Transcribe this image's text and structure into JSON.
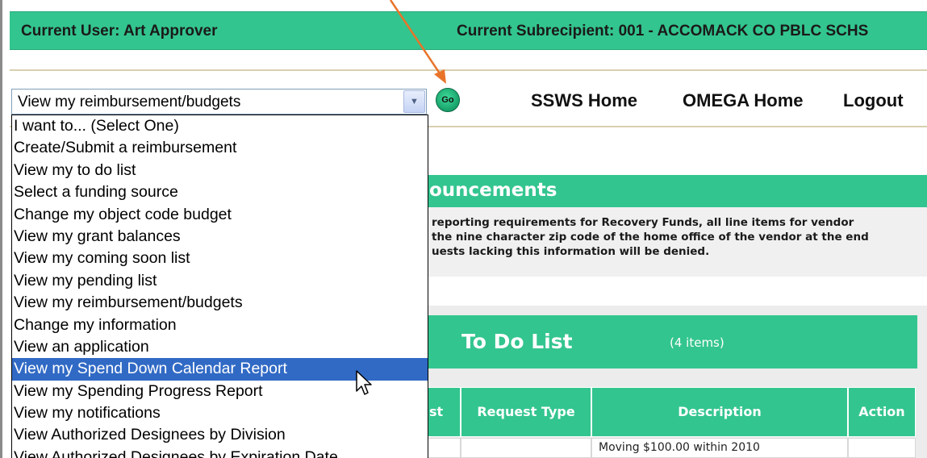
{
  "header": {
    "current_user": "Current User: Art Approver",
    "current_subrecipient": "Current Subrecipient: 001 - ACCOMACK CO PBLC SCHS"
  },
  "action_select": {
    "value": "View my reimbursement/budgets",
    "go_label": "Go",
    "options": [
      "I want to... (Select One)",
      "Create/Submit a reimbursement",
      "View my to do list",
      "Select a funding source",
      "Change my object code budget",
      "View my grant balances",
      "View my coming soon list",
      "View my pending list",
      "View my reimbursement/budgets",
      "Change my information",
      "View an application",
      "View my Spend Down Calendar Report",
      "View my Spending Progress Report",
      "View my notifications",
      "View Authorized Designees by Division",
      "View Authorized Designees by Expiration Date"
    ],
    "highlighted_option": "View my Spend Down Calendar Report"
  },
  "nav": {
    "ssws_home": "SSWS Home",
    "omega_home": "OMEGA Home",
    "logout": "Logout"
  },
  "announcements": {
    "title": "ouncements",
    "lines": [
      "reporting requirements for Recovery Funds, all line items for vendor",
      "the nine character zip code of the home office of the vendor at the end",
      "uests lacking this information will be denied."
    ]
  },
  "todo": {
    "title": "To Do List",
    "count": "(4 items)",
    "columns": [
      "st",
      "Request Type",
      "Description",
      "Action"
    ],
    "first_row_description": "Moving $100.00 within 2010"
  },
  "colors": {
    "accent_green": "#33c58f",
    "selection_blue": "#316ac5",
    "annotation_arrow": "#e8742a"
  },
  "icons": {
    "select_arrow": "chevron-down-icon",
    "annotation": "arrow-icon",
    "cursor": "mouse-pointer-icon"
  }
}
